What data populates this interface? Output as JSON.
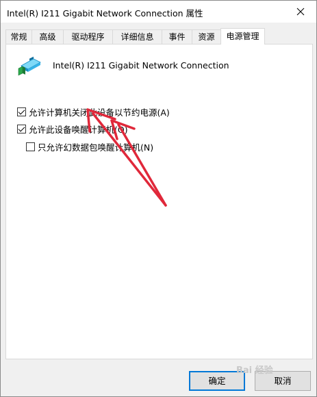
{
  "window": {
    "title": "Intel(R) I211 Gigabit Network Connection 属性"
  },
  "tabs": [
    {
      "label": "常规",
      "active": false
    },
    {
      "label": "高级",
      "active": false
    },
    {
      "label": "驱动程序",
      "active": false
    },
    {
      "label": "详细信息",
      "active": false
    },
    {
      "label": "事件",
      "active": false
    },
    {
      "label": "资源",
      "active": false
    },
    {
      "label": "电源管理",
      "active": true
    }
  ],
  "device": {
    "name": "Intel(R) I211 Gigabit Network Connection",
    "icon": "network-adapter-icon"
  },
  "power": {
    "allow_off": {
      "label": "允许计算机关闭此设备以节约电源(A)",
      "checked": true
    },
    "allow_wake": {
      "label": "允许此设备唤醒计算机(O)",
      "checked": true
    },
    "magic_packet": {
      "label": "只允许幻数据包唤醒计算机(N)",
      "checked": false
    }
  },
  "buttons": {
    "ok": "确定",
    "cancel": "取消"
  },
  "watermark": "Bai 经验",
  "colors": {
    "annotation_arrow": "#e0283a",
    "default_button_border": "#0078d7"
  }
}
